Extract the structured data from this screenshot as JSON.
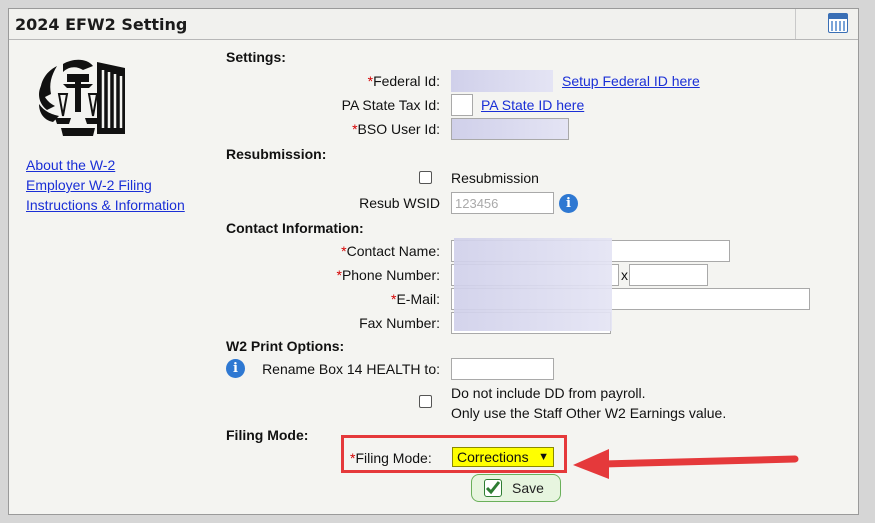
{
  "header": {
    "title": "2024 EFW2 Setting",
    "icon": "calendar-icon"
  },
  "logo": {
    "icon": "irs-eagle-logo"
  },
  "left_links": [
    {
      "label": "About the W-2"
    },
    {
      "label": "Employer W-2 Filing"
    },
    {
      "label": "Instructions & Information"
    }
  ],
  "sections": {
    "settings": "Settings:",
    "resubmission": "Resubmission:",
    "contact": "Contact Information:",
    "w2print": "W2 Print Options:",
    "filing": "Filing Mode:"
  },
  "required_mark": "*",
  "settings": {
    "federal_id_label": "Federal Id:",
    "federal_id_link": "Setup Federal ID here",
    "pa_state_label": "PA State Tax Id:",
    "pa_state_link": "PA State ID here",
    "bso_label": "BSO User Id:"
  },
  "resubmission": {
    "checkbox_label": "Resubmission",
    "checked": false,
    "wsid_label": "Resub WSID",
    "wsid_placeholder": "123456"
  },
  "contact": {
    "name_label": "Contact Name:",
    "phone_label": "Phone Number:",
    "ext_label": "x",
    "email_label": "E-Mail:",
    "fax_label": "Fax Number:"
  },
  "w2print": {
    "rename_label": "Rename Box 14 HEALTH to:",
    "rename_value": "",
    "dd_line1": "Do not include DD from payroll.",
    "dd_line2": "Only use the Staff Other W2 Earnings value.",
    "dd_checked": false
  },
  "filing": {
    "label": "Filing Mode:",
    "selected": "Corrections",
    "highlight_color": "#ffff00",
    "annotation_color": "#e5393b"
  },
  "save_label": "Save"
}
